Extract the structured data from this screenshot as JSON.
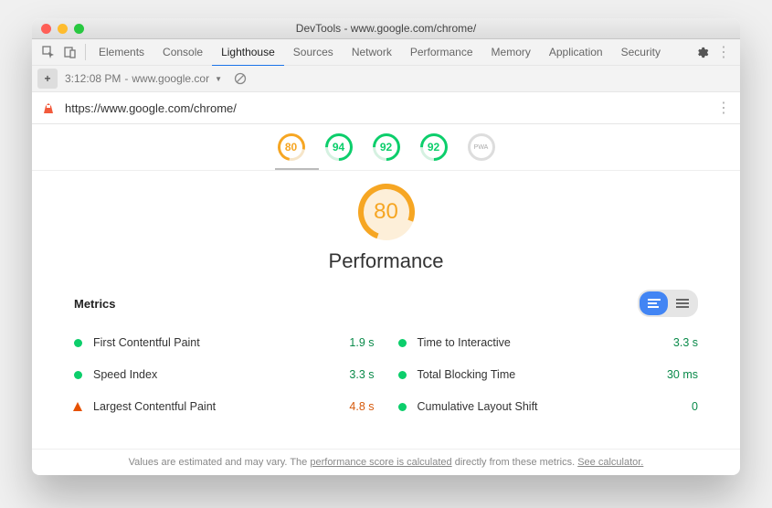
{
  "window": {
    "title": "DevTools - www.google.com/chrome/"
  },
  "devtools": {
    "tabs": [
      "Elements",
      "Console",
      "Lighthouse",
      "Sources",
      "Network",
      "Performance",
      "Memory",
      "Application",
      "Security"
    ],
    "active_tab": "Lighthouse"
  },
  "subbar": {
    "timestamp": "3:12:08 PM",
    "host": "www.google.cor",
    "dropdown_glyph": "▼"
  },
  "url": "https://www.google.com/chrome/",
  "gauges": {
    "items": [
      {
        "score": "80",
        "tone": "orange"
      },
      {
        "score": "94",
        "tone": "green"
      },
      {
        "score": "92",
        "tone": "green"
      },
      {
        "score": "92",
        "tone": "green"
      },
      {
        "score": "PWA",
        "tone": "grey"
      }
    ]
  },
  "main": {
    "score": "80",
    "label": "Performance"
  },
  "metrics_title": "Metrics",
  "metrics": [
    {
      "dot": "green",
      "name": "First Contentful Paint",
      "value": "1.9 s",
      "vtone": "green"
    },
    {
      "dot": "green",
      "name": "Time to Interactive",
      "value": "3.3 s",
      "vtone": "green"
    },
    {
      "dot": "green",
      "name": "Speed Index",
      "value": "3.3 s",
      "vtone": "green"
    },
    {
      "dot": "green",
      "name": "Total Blocking Time",
      "value": "30 ms",
      "vtone": "green"
    },
    {
      "dot": "tri",
      "name": "Largest Contentful Paint",
      "value": "4.8 s",
      "vtone": "orange"
    },
    {
      "dot": "green",
      "name": "Cumulative Layout Shift",
      "value": "0",
      "vtone": "green"
    }
  ],
  "footer": {
    "pre": "Values are estimated and may vary. The ",
    "link1": "performance score is calculated",
    "mid": " directly from these metrics. ",
    "link2": "See calculator."
  }
}
